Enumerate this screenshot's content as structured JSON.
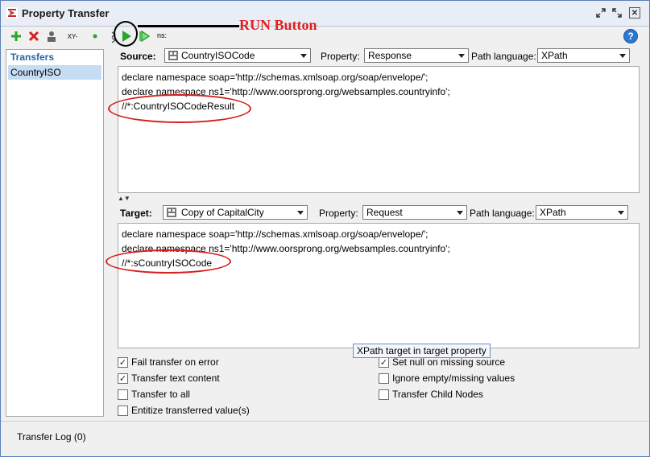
{
  "window": {
    "title": "Property Transfer",
    "icons": [
      "transfer-app-icon",
      "detach-icon",
      "maximize-icon",
      "close-icon"
    ]
  },
  "left_toolbar": {
    "add_icon": "plus-icon",
    "delete_icon": "x-icon",
    "rename_icon": "person-icon",
    "xy_label": "XY-",
    "dot_icon": "status-dot-icon"
  },
  "transfers": {
    "header": "Transfers",
    "items": [
      {
        "label": "CountryISO"
      }
    ]
  },
  "run_toolbar": {
    "run_icon": "play-icon",
    "run_all_icon": "play-all-icon",
    "ns_label": "ns:",
    "annotation": "RUN Button",
    "help_icon": "?"
  },
  "source": {
    "label": "Source:",
    "step": "CountryISOCode",
    "property_label": "Property:",
    "property": "Response",
    "path_language_label": "Path language:",
    "path_language": "XPath",
    "lines": [
      "declare namespace soap='http://schemas.xmlsoap.org/soap/envelope/';",
      "declare namespace ns1='http://www.oorsprong.org/websamples.countryinfo';",
      "//*:CountryISOCodeResult"
    ]
  },
  "target": {
    "label": "Target:",
    "step": "Copy of CapitalCity",
    "property_label": "Property:",
    "property": "Request",
    "path_language_label": "Path language:",
    "path_language": "XPath",
    "lines": [
      "declare namespace soap='http://schemas.xmlsoap.org/soap/envelope/';",
      "declare namespace ns1='http://www.oorsprong.org/websamples.countryinfo';",
      "//*:sCountryISOCode"
    ]
  },
  "tooltip": "XPath target in target property",
  "options": {
    "fail_transfer": {
      "label": "Fail transfer on error",
      "checked": true
    },
    "transfer_text": {
      "label": "Transfer text content",
      "checked": true
    },
    "transfer_all": {
      "label": "Transfer to all",
      "checked": false
    },
    "entitize": {
      "label": "Entitize transferred value(s)",
      "checked": false
    },
    "set_null": {
      "label": "Set null on missing source",
      "checked": true
    },
    "ignore_empty": {
      "label": "Ignore empty/missing values",
      "checked": false
    },
    "transfer_child": {
      "label": "Transfer Child Nodes",
      "checked": false
    }
  },
  "transfer_log": "Transfer Log (0)",
  "colors": {
    "accent": "#2a64b0",
    "selection": "#c5dcf5",
    "annotation": "#d61f1f",
    "run_green": "#2aa52a"
  }
}
